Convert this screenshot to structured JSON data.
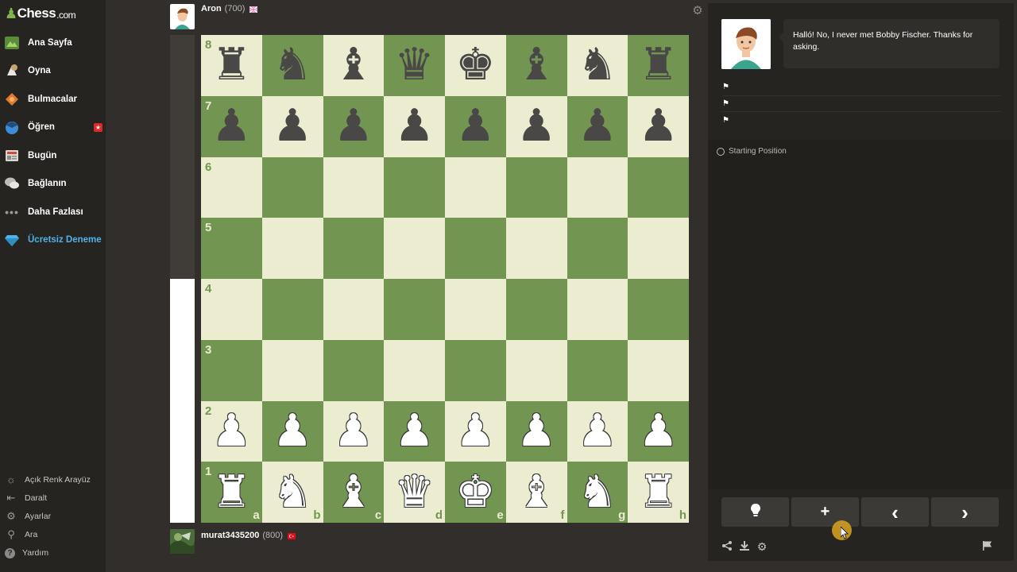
{
  "sidebar": {
    "logo": {
      "brand": "Chess",
      "suffix": ".com"
    },
    "items": [
      {
        "label": "Ana Sayfa",
        "icon": "home-icon"
      },
      {
        "label": "Oyna",
        "icon": "play-icon"
      },
      {
        "label": "Bulmacalar",
        "icon": "puzzle-icon"
      },
      {
        "label": "Öğren",
        "icon": "learn-icon",
        "badge": "★"
      },
      {
        "label": "Bugün",
        "icon": "news-icon"
      },
      {
        "label": "Bağlanın",
        "icon": "social-icon"
      },
      {
        "label": "Daha Fazlası",
        "icon": "more-icon"
      },
      {
        "label": "Ücretsiz Deneme",
        "icon": "diamond-icon"
      }
    ],
    "bottom": [
      {
        "label": "Açık Renk Arayüz",
        "icon": "sun-icon",
        "glyph": "☼"
      },
      {
        "label": "Daralt",
        "icon": "collapse-icon",
        "glyph": "⇤"
      },
      {
        "label": "Ayarlar",
        "icon": "gear-icon",
        "glyph": "⚙"
      },
      {
        "label": "Ara",
        "icon": "search-icon",
        "glyph": "⚲"
      },
      {
        "label": "Yardım",
        "icon": "help-icon",
        "glyph": "?"
      }
    ]
  },
  "top_player": {
    "name": "Aron",
    "rating": "(700)"
  },
  "bottom_player": {
    "name": "murat3435200",
    "rating": "(800)"
  },
  "board": {
    "colors": {
      "light": "#ebecd0",
      "dark": "#739552"
    },
    "ranks": [
      "8",
      "7",
      "6",
      "5",
      "4",
      "3",
      "2",
      "1"
    ],
    "files": [
      "a",
      "b",
      "c",
      "d",
      "e",
      "f",
      "g",
      "h"
    ],
    "position": [
      [
        "b-rook",
        "b-knight",
        "b-bishop",
        "b-queen",
        "b-king",
        "b-bishop",
        "b-knight",
        "b-rook"
      ],
      [
        "b-pawn",
        "b-pawn",
        "b-pawn",
        "b-pawn",
        "b-pawn",
        "b-pawn",
        "b-pawn",
        "b-pawn"
      ],
      [
        "",
        "",
        "",
        "",
        "",
        "",
        "",
        ""
      ],
      [
        "",
        "",
        "",
        "",
        "",
        "",
        "",
        ""
      ],
      [
        "",
        "",
        "",
        "",
        "",
        "",
        "",
        ""
      ],
      [
        "",
        "",
        "",
        "",
        "",
        "",
        "",
        ""
      ],
      [
        "w-pawn",
        "w-pawn",
        "w-pawn",
        "w-pawn",
        "w-pawn",
        "w-pawn",
        "w-pawn",
        "w-pawn"
      ],
      [
        "w-rook",
        "w-knight",
        "w-bishop",
        "w-queen",
        "w-king",
        "w-bishop",
        "w-knight",
        "w-rook"
      ]
    ]
  },
  "eval": {
    "white_fraction": 0.5
  },
  "coach": {
    "message": "Halló! No, I never met Bobby Fischer. Thanks for asking."
  },
  "moves": {
    "start_label": "Starting Position"
  },
  "controls": {
    "hint": "💡",
    "add": "+",
    "prev": "‹",
    "next": "›"
  }
}
